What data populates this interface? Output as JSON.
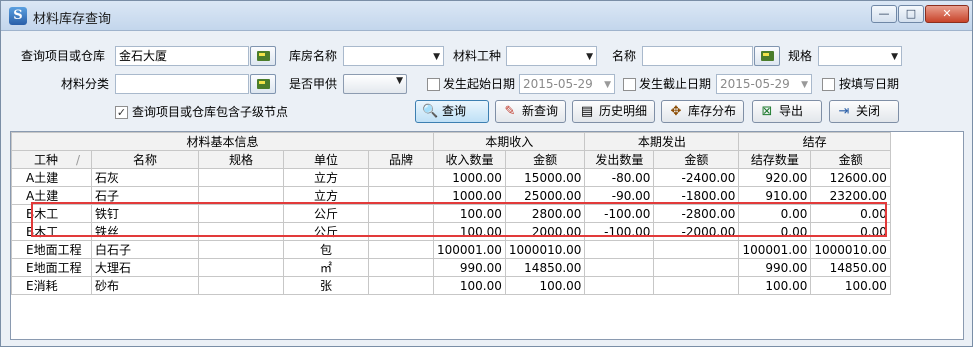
{
  "window": {
    "title": "材料库存查询",
    "min_label": "—",
    "max_label": "□",
    "close_label": "✕"
  },
  "filters": {
    "project_label": "查询项目或仓库",
    "project_value": "金石大厦",
    "room_label": "库房名称",
    "room_value": "",
    "material_type_label": "材料工种",
    "material_type_value": "",
    "name_label": "名称",
    "name_value": "",
    "spec_label": "规格",
    "spec_value": "",
    "category_label": "材料分类",
    "category_value": "",
    "supplied_label": "是否甲供",
    "supplied_value": "",
    "start_date_label": "发生起始日期",
    "start_date_value": "2015-05-29",
    "end_date_label": "发生截止日期",
    "end_date_value": "2015-05-29",
    "fill_date_label": "按填写日期",
    "include_children_label": "查询项目或仓库包含子级节点",
    "include_children_checked": true
  },
  "toolbar": {
    "query": "查询",
    "new_query": "新查询",
    "history": "历史明细",
    "distribution": "库存分布",
    "export": "导出",
    "close": "关闭"
  },
  "grid": {
    "group_headers": {
      "basic": "材料基本信息",
      "income": "本期收入",
      "issue": "本期发出",
      "balance": "结存"
    },
    "columns": [
      "工种",
      "名称",
      "规格",
      "单位",
      "品牌",
      "收入数量",
      "金额",
      "发出数量",
      "金额",
      "结存数量",
      "金额"
    ],
    "sort_indicator": "/",
    "rows": [
      {
        "kind": "A土建",
        "name": "石灰",
        "spec": "",
        "unit": "立方",
        "brand": "",
        "in_qty": "1000.00",
        "in_amt": "15000.00",
        "out_qty": "-80.00",
        "out_amt": "-2400.00",
        "bal_qty": "920.00",
        "bal_amt": "12600.00"
      },
      {
        "kind": "A土建",
        "name": "石子",
        "spec": "",
        "unit": "立方",
        "brand": "",
        "in_qty": "1000.00",
        "in_amt": "25000.00",
        "out_qty": "-90.00",
        "out_amt": "-1800.00",
        "bal_qty": "910.00",
        "bal_amt": "23200.00"
      },
      {
        "kind": "B木工",
        "name": "铁钉",
        "spec": "",
        "unit": "公斤",
        "brand": "",
        "in_qty": "100.00",
        "in_amt": "2800.00",
        "out_qty": "-100.00",
        "out_amt": "-2800.00",
        "bal_qty": "0.00",
        "bal_amt": "0.00"
      },
      {
        "kind": "B木工",
        "name": "铁丝",
        "spec": "",
        "unit": "公斤",
        "brand": "",
        "in_qty": "100.00",
        "in_amt": "2000.00",
        "out_qty": "-100.00",
        "out_amt": "-2000.00",
        "bal_qty": "0.00",
        "bal_amt": "0.00"
      },
      {
        "kind": "E地面工程",
        "name": "白石子",
        "spec": "",
        "unit": "包",
        "brand": "",
        "in_qty": "100001.00",
        "in_amt": "1000010.00",
        "out_qty": "",
        "out_amt": "",
        "bal_qty": "100001.00",
        "bal_amt": "1000010.00"
      },
      {
        "kind": "E地面工程",
        "name": "大理石",
        "spec": "",
        "unit": "㎡",
        "brand": "",
        "in_qty": "990.00",
        "in_amt": "14850.00",
        "out_qty": "",
        "out_amt": "",
        "bal_qty": "990.00",
        "bal_amt": "14850.00"
      },
      {
        "kind": "E消耗",
        "name": "砂布",
        "spec": "",
        "unit": "张",
        "brand": "",
        "in_qty": "100.00",
        "in_amt": "100.00",
        "out_qty": "",
        "out_amt": "",
        "bal_qty": "100.00",
        "bal_amt": "100.00"
      }
    ]
  }
}
